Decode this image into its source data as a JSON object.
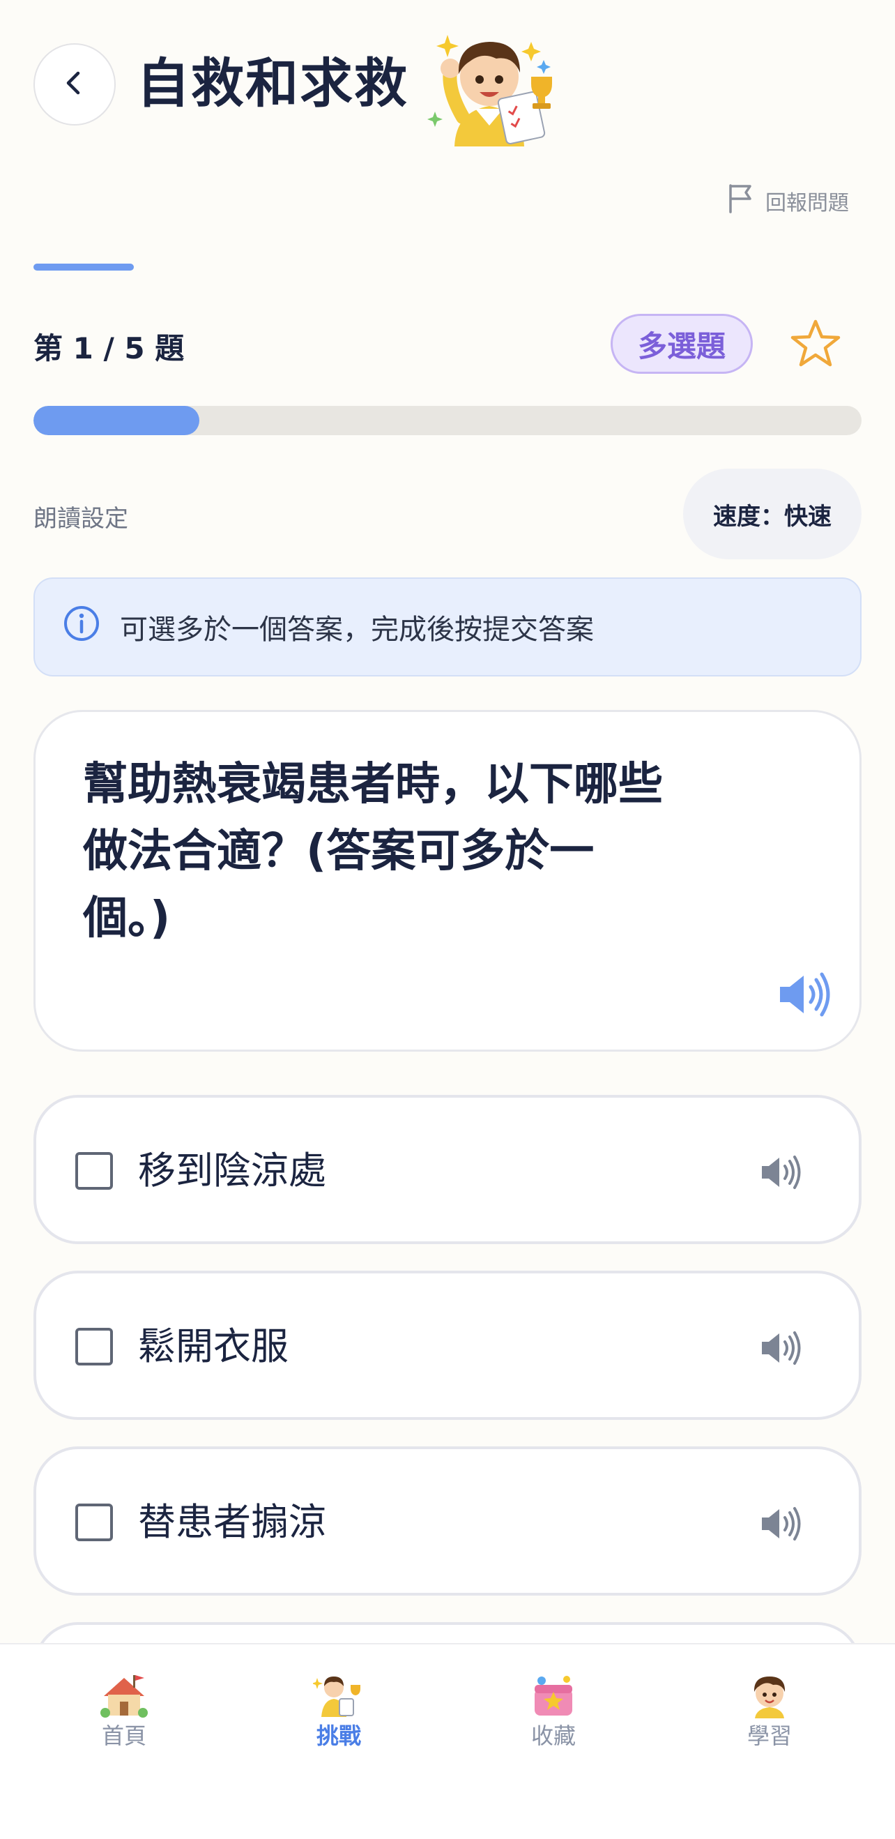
{
  "header": {
    "title": "自救和求救",
    "back_icon": "chevron-left-icon",
    "mascot": "boy-with-checklist-trophy-mascot"
  },
  "report": {
    "label": "回報問題",
    "icon": "flag-icon"
  },
  "quiz": {
    "counter": "第 1 / 5 題",
    "type_badge": "多選題",
    "favorite_icon": "star-icon",
    "current": 1,
    "total": 5,
    "progress_fraction": 0.2
  },
  "read_settings": {
    "label": "朗讀設定",
    "speed": "速度：快速"
  },
  "hint": {
    "icon": "info-icon",
    "text": "可選多於一個答案，完成後按提交答案"
  },
  "question": {
    "line1": "幫助熱衰竭患者時，以下哪些",
    "line2": "做法合適？(答案可多於一",
    "line3": "個。)",
    "speaker_icon": "speaker-icon"
  },
  "options": [
    {
      "label": "移到陰涼處",
      "checked": false
    },
    {
      "label": "鬆開衣服",
      "checked": false
    },
    {
      "label": "替患者搧涼",
      "checked": false
    }
  ],
  "bottom_nav": [
    {
      "label": "首頁",
      "icon": "home-icon",
      "active": false
    },
    {
      "label": "挑戰",
      "icon": "challenge-icon",
      "active": true
    },
    {
      "label": "收藏",
      "icon": "collection-icon",
      "active": false
    },
    {
      "label": "學習",
      "icon": "learn-icon",
      "active": false
    }
  ],
  "colors": {
    "accent_blue": "#6e9bf0",
    "badge_purple": "#7b5fd9",
    "star_orange": "#f0a83a",
    "text_dark": "#1b2440"
  }
}
